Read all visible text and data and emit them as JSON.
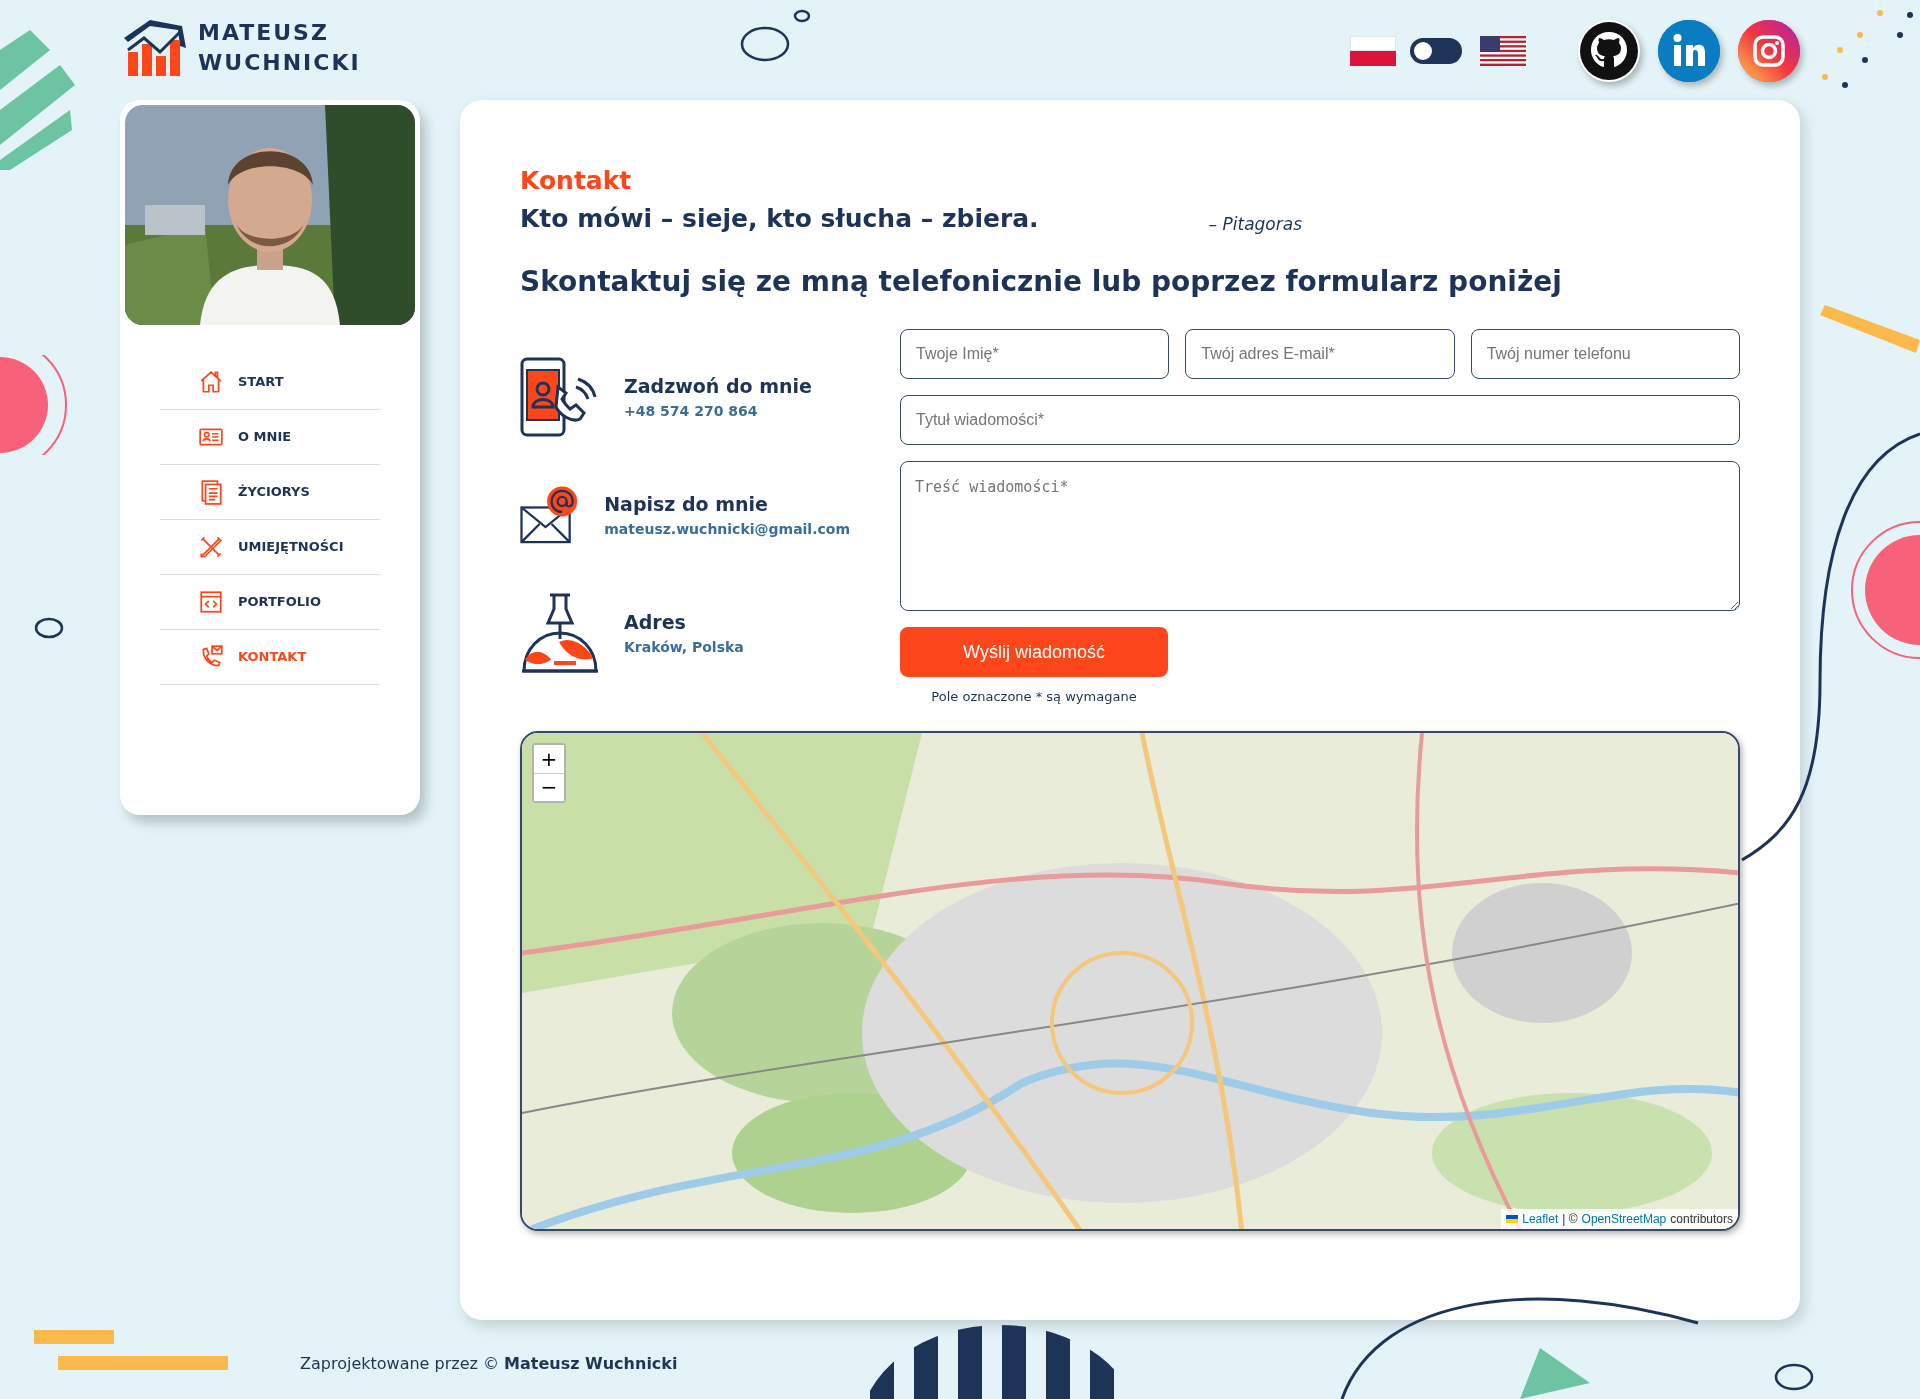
{
  "logo": {
    "line_1": "MATEUSZ",
    "line_2": "WUCHNICKI"
  },
  "language_switch": {
    "on": false
  },
  "social_links": [
    {
      "kind": "github"
    },
    {
      "kind": "linkedin"
    },
    {
      "kind": "instagram"
    }
  ],
  "sidebar": {
    "items": [
      {
        "label": "START",
        "selected": false
      },
      {
        "label": "O MNIE",
        "selected": false
      },
      {
        "label": "ŻYCIORYS",
        "selected": false
      },
      {
        "label": "UMIEJĘTNOŚCI",
        "selected": false
      },
      {
        "label": "PORTFOLIO",
        "selected": false
      },
      {
        "label": "KONTAKT",
        "selected": true
      }
    ]
  },
  "page_title": "Kontakt",
  "quote": {
    "text": "Kto mówi – sieje, kto słucha – zbiera.",
    "author": "– Pitagoras"
  },
  "heading": "Skontaktuj się ze mną telefonicznie lub poprzez formularz poniżej",
  "contact_items": [
    {
      "kind": "phone",
      "title": "Zadzwoń do mnie",
      "value": "+48 574 270 864"
    },
    {
      "kind": "email",
      "title": "Napisz do mnie",
      "value": "mateusz.wuchnicki@gmail.com"
    },
    {
      "kind": "address",
      "title": "Adres",
      "value": "Kraków, Polska"
    }
  ],
  "form": {
    "fields": [
      {
        "kind": "input",
        "placeholder": "Twoje Imię*"
      },
      {
        "kind": "input",
        "placeholder": "Twój adres E-mail*"
      },
      {
        "kind": "input",
        "placeholder": "Twój numer telefonu"
      },
      {
        "kind": "wide",
        "placeholder": "Tytuł wiadomości*"
      },
      {
        "kind": "textarea",
        "placeholder": "Treść wiadomości*"
      }
    ],
    "submit": "Wyślij wiadomość",
    "note": "Pole oznaczone * są wymagane"
  },
  "map": {
    "zoom_in": "+",
    "zoom_out": "−",
    "attribution": {
      "leaflet": "Leaflet",
      "separator": "| ©",
      "osm": "OpenStreetMap",
      "suffix": "contributors"
    }
  },
  "footer": "Zaprojektowane przez © **Mateusz Wuchnicki**"
}
